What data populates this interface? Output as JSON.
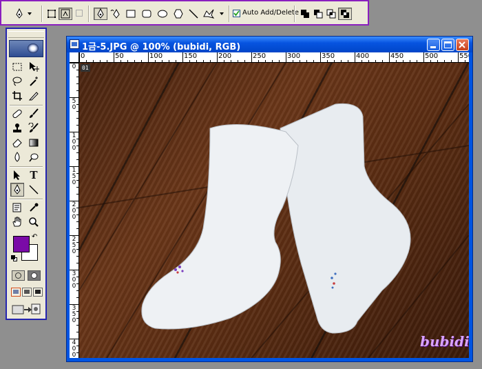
{
  "options_bar": {
    "auto_add_delete_label": "Auto Add/Delete",
    "auto_add_delete_checked": true,
    "accent_color": "#8a1ebe"
  },
  "tools_palette": {
    "tools": [
      "marquee",
      "move",
      "lasso",
      "magic-wand",
      "crop",
      "slice",
      "healing-brush",
      "brush",
      "clone-stamp",
      "history-brush",
      "eraser",
      "gradient",
      "blur",
      "dodge",
      "path-selection",
      "type",
      "pen",
      "line",
      "notes",
      "eyedropper",
      "hand",
      "zoom"
    ],
    "type_tool_glyph": "T",
    "foreground_color": "#7a0aa7",
    "background_color": "#ffffff"
  },
  "document": {
    "title": "1금-5.JPG @ 100% (bubidi, RGB)",
    "layer_badge": "01",
    "watermark": "bubidi",
    "ruler_h_labels": [
      "0",
      "50",
      "100",
      "150",
      "200",
      "250",
      "300",
      "350",
      "400",
      "450",
      "500",
      "550"
    ],
    "ruler_v_labels": [
      "0",
      "50",
      "100",
      "150",
      "200",
      "250",
      "300",
      "350",
      "400"
    ]
  }
}
